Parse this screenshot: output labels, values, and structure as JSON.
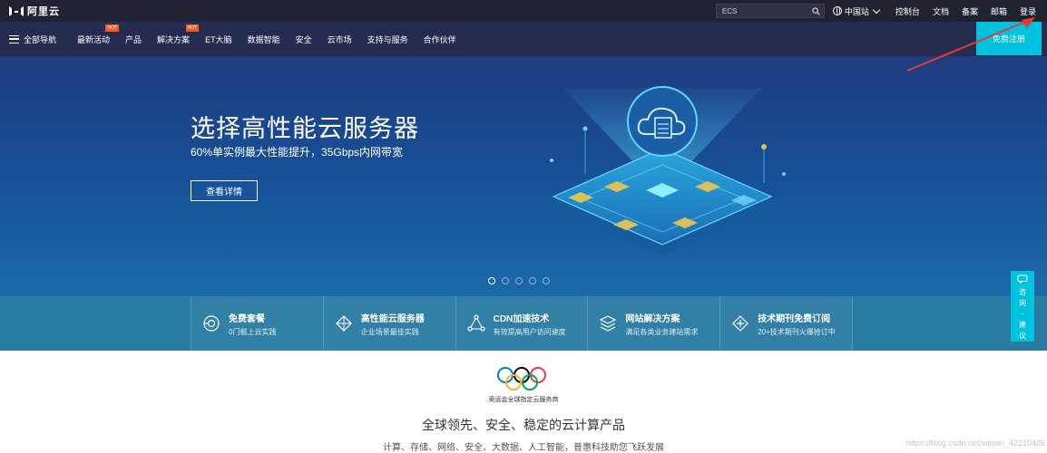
{
  "topbar": {
    "logo_text": "阿里云",
    "search_value": "ECS",
    "region": "中国站",
    "links": [
      "控制台",
      "文档",
      "备案",
      "邮箱",
      "登录"
    ]
  },
  "nav": {
    "all_nav": "全部导航",
    "items": [
      {
        "label": "最新活动",
        "badge": "HOT"
      },
      {
        "label": "产品",
        "badge": ""
      },
      {
        "label": "解决方案",
        "badge": "HOT"
      },
      {
        "label": "ET大脑",
        "badge": ""
      },
      {
        "label": "数据智能",
        "badge": ""
      },
      {
        "label": "安全",
        "badge": ""
      },
      {
        "label": "云市场",
        "badge": ""
      },
      {
        "label": "支持与服务",
        "badge": ""
      },
      {
        "label": "合作伙伴",
        "badge": ""
      }
    ],
    "register": "免费注册"
  },
  "hero": {
    "title": "选择高性能云服务器",
    "subtitle": "60%单实例最大性能提升，35Gbps内网带宽",
    "button": "查看详情",
    "slides_total": 5,
    "active_slide": 1
  },
  "features": [
    {
      "title": "免费套餐",
      "desc": "0门槛上云实践",
      "icon": "free-package-icon"
    },
    {
      "title": "高性能云服务器",
      "desc": "企业场景最佳实践",
      "icon": "server-icon"
    },
    {
      "title": "CDN加速技术",
      "desc": "有效提高用户访问速度",
      "icon": "cdn-network-icon"
    },
    {
      "title": "网站解决方案",
      "desc": "满足各类业务建站需求",
      "icon": "website-solution-icon"
    },
    {
      "title": "技术期刊免费订阅",
      "desc": "20+技术期刊火爆抢订中",
      "icon": "journal-icon"
    }
  ],
  "consult": {
    "chars": [
      "咨",
      "询",
      "·",
      "建",
      "议"
    ]
  },
  "bottom": {
    "olympic_caption": "奥运会全球指定云服务商",
    "title": "全球领先、安全、稳定的云计算产品",
    "subtitle": "计算、存储、网络、安全、大数据、人工智能，普惠科技助您飞跃发展"
  },
  "watermark": "https://blog.csdn.net/weixin_42210426",
  "colors": {
    "accent": "#00c1de",
    "hot": "#f15a24",
    "topbar": "#1f2230",
    "nav": "#252c4f"
  }
}
